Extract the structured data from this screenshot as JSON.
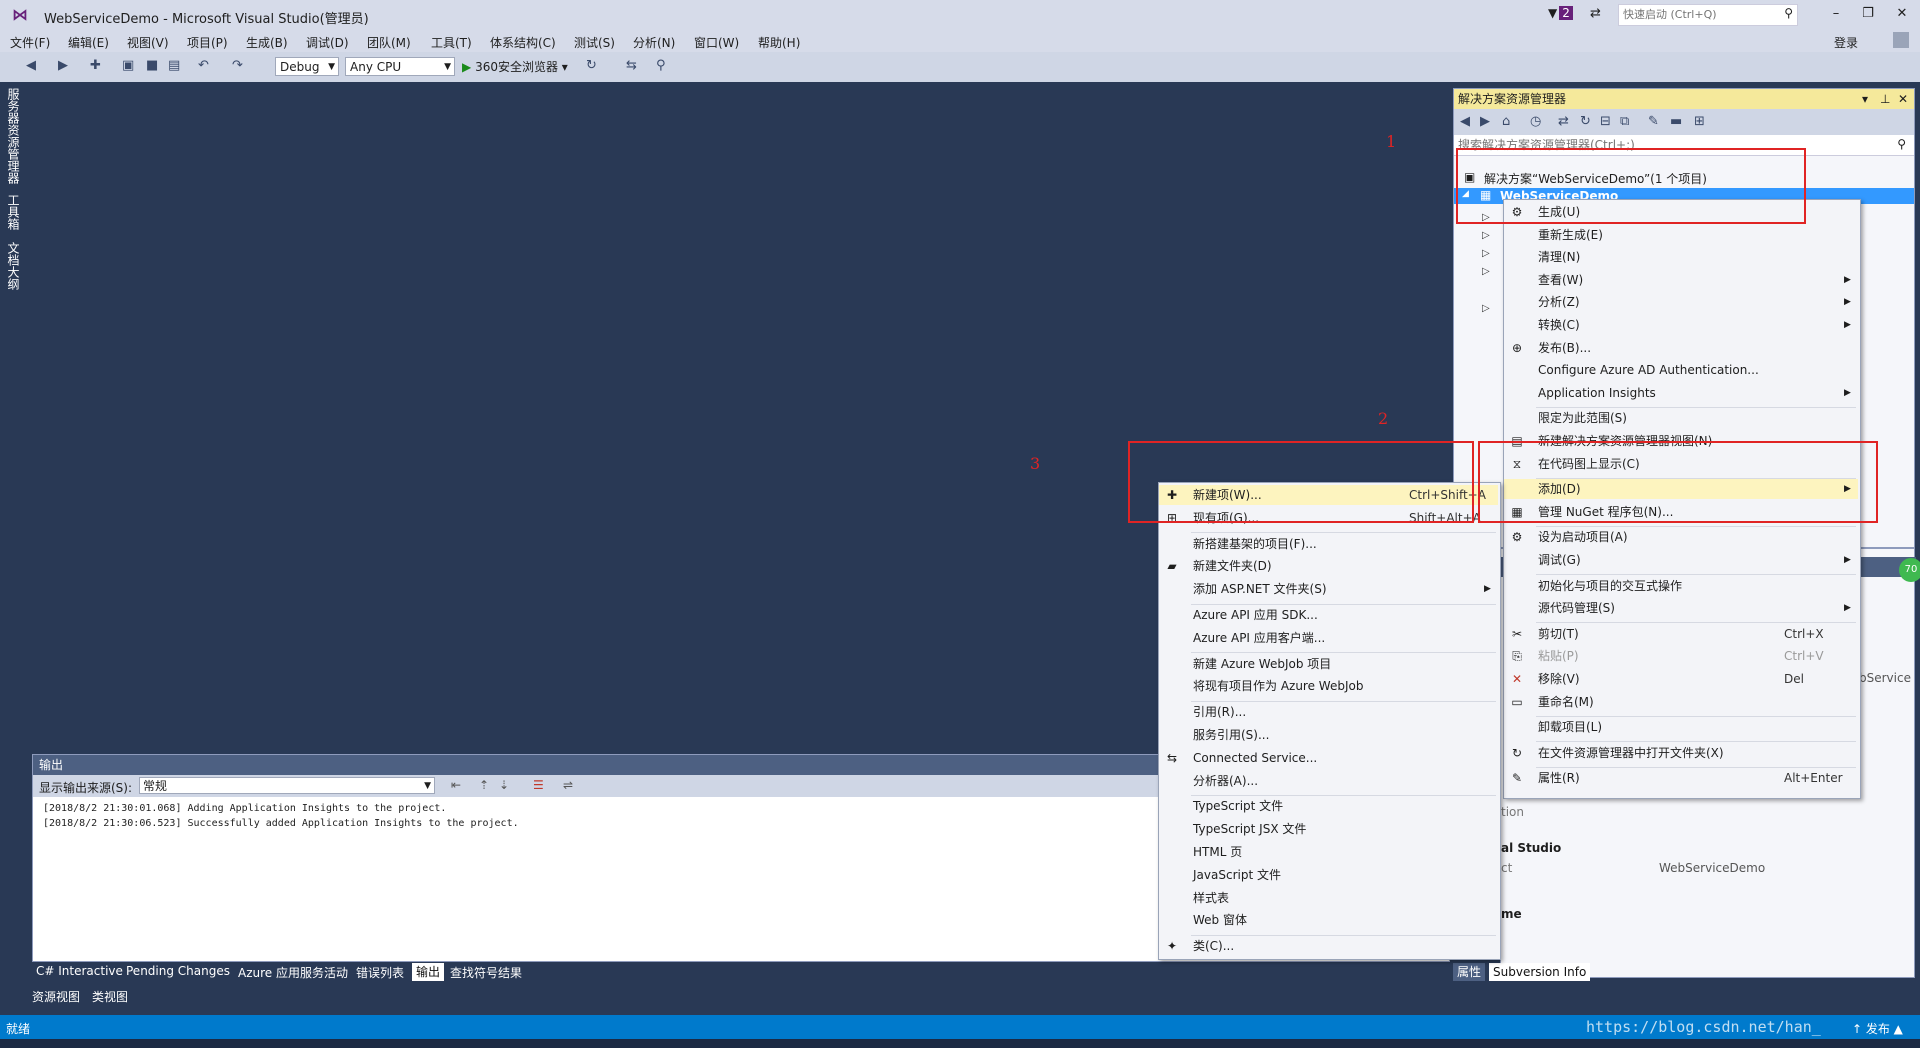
{
  "window": {
    "title": "WebServiceDemo - Microsoft Visual Studio(管理员)",
    "notification_count": "2",
    "quick_launch_placeholder": "快速启动 (Ctrl+Q)",
    "login": "登录"
  },
  "menubar": [
    "文件(F)",
    "编辑(E)",
    "视图(V)",
    "项目(P)",
    "生成(B)",
    "调试(D)",
    "团队(M)",
    "工具(T)",
    "体系结构(C)",
    "测试(S)",
    "分析(N)",
    "窗口(W)",
    "帮助(H)"
  ],
  "toolbar": {
    "configuration": "Debug",
    "platform": "Any CPU",
    "run_target": "360安全浏览器"
  },
  "left_tabs": [
    "服务器资源管理器",
    "工具箱",
    "文档大纲"
  ],
  "solution_explorer": {
    "title": "解决方案资源管理器",
    "search_placeholder": "搜索解决方案资源管理器(Ctrl+;)",
    "solution_node": "解决方案“WebServiceDemo”(1 个项目)",
    "project_node": "WebServiceDemo"
  },
  "project_menu": [
    {
      "icon": "build-icon",
      "label": "生成(U)"
    },
    {
      "label": "重新生成(E)"
    },
    {
      "label": "清理(N)"
    },
    {
      "label": "查看(W)",
      "submenu": true
    },
    {
      "label": "分析(Z)",
      "submenu": true
    },
    {
      "label": "转换(C)",
      "submenu": true
    },
    {
      "icon": "publish-icon",
      "label": "发布(B)..."
    },
    {
      "label": "Configure Azure AD Authentication..."
    },
    {
      "label": "Application Insights",
      "submenu": true
    },
    {
      "sep": true
    },
    {
      "label": "限定为此范围(S)"
    },
    {
      "icon": "new-view-icon",
      "label": "新建解决方案资源管理器视图(N)"
    },
    {
      "icon": "code-map-icon",
      "label": "在代码图上显示(C)"
    },
    {
      "sep": true
    },
    {
      "label": "添加(D)",
      "submenu": true,
      "highlight": true
    },
    {
      "icon": "nuget-icon",
      "label": "管理 NuGet 程序包(N)..."
    },
    {
      "sep": true
    },
    {
      "icon": "gear-icon",
      "label": "设为启动项目(A)"
    },
    {
      "label": "调试(G)",
      "submenu": true
    },
    {
      "sep": true
    },
    {
      "label": "初始化与项目的交互式操作"
    },
    {
      "label": "源代码管理(S)",
      "submenu": true
    },
    {
      "sep": true
    },
    {
      "icon": "cut-icon",
      "label": "剪切(T)",
      "shortcut": "Ctrl+X"
    },
    {
      "icon": "paste-icon",
      "label": "粘贴(P)",
      "shortcut": "Ctrl+V",
      "disabled": true
    },
    {
      "icon": "remove-icon",
      "label": "移除(V)",
      "shortcut": "Del"
    },
    {
      "icon": "rename-icon",
      "label": "重命名(M)"
    },
    {
      "sep": true
    },
    {
      "label": "卸载项目(L)"
    },
    {
      "sep": true
    },
    {
      "icon": "open-folder-icon",
      "label": "在文件资源管理器中打开文件夹(X)"
    },
    {
      "sep": true
    },
    {
      "icon": "wrench-icon",
      "label": "属性(R)",
      "shortcut": "Alt+Enter"
    }
  ],
  "add_menu": [
    {
      "icon": "new-item-icon",
      "label": "新建项(W)...",
      "shortcut": "Ctrl+Shift+A",
      "highlight": true
    },
    {
      "icon": "existing-item-icon",
      "label": "现有项(G)...",
      "shortcut": "Shift+Alt+A"
    },
    {
      "sep": true
    },
    {
      "label": "新搭建基架的项目(F)..."
    },
    {
      "icon": "folder-icon",
      "label": "新建文件夹(D)"
    },
    {
      "label": "添加 ASP.NET 文件夹(S)",
      "submenu": true
    },
    {
      "sep": true
    },
    {
      "label": "Azure API 应用 SDK..."
    },
    {
      "label": "Azure API 应用客户端..."
    },
    {
      "sep": true
    },
    {
      "label": "新建 Azure WebJob 项目"
    },
    {
      "label": "将现有项目作为 Azure WebJob"
    },
    {
      "sep": true
    },
    {
      "label": "引用(R)..."
    },
    {
      "label": "服务引用(S)..."
    },
    {
      "icon": "connected-service-icon",
      "label": "Connected Service..."
    },
    {
      "label": "分析器(A)..."
    },
    {
      "sep": true
    },
    {
      "label": "TypeScript 文件"
    },
    {
      "label": "TypeScript JSX 文件"
    },
    {
      "label": "HTML 页"
    },
    {
      "label": "JavaScript 文件"
    },
    {
      "label": "样式表"
    },
    {
      "label": "Web 窗体"
    },
    {
      "sep": true
    },
    {
      "icon": "class-icon",
      "label": "类(C)..."
    }
  ],
  "output": {
    "title": "输出",
    "source_label": "显示输出来源(S):",
    "source_value": "常规",
    "lines": [
      "[2018/8/2 21:30:01.068] Adding Application Insights to the project.",
      "[2018/8/2 21:30:06.523] Successfully added Application Insights to the project."
    ]
  },
  "bottom_tabs": [
    "C# Interactive",
    "Pending Changes",
    "Azure 应用服务活动",
    "错误列表",
    "输出",
    "查找符号结果"
  ],
  "bottom_tabs2": [
    "资源视图",
    "类视图"
  ],
  "properties_fragment": {
    "frag1": "bService",
    "frag2": "tion",
    "frag3": "al Studio",
    "frag4": "ct",
    "frag5": "WebServiceDemo",
    "frag6": "me",
    "green_badge": "70"
  },
  "properties_tabs": [
    "属性",
    "Subversion Info"
  ],
  "status": {
    "ready": "就绪",
    "watermark": "https://blog.csdn.net/han_",
    "publish": "↑ 发布 ▲"
  },
  "annotations": [
    "1",
    "2",
    "3"
  ],
  "colors": {
    "accent_red": "#e02424",
    "status_blue": "#007acc",
    "selection_blue": "#3399ff",
    "highlight_yellow": "#fdf4bf"
  }
}
